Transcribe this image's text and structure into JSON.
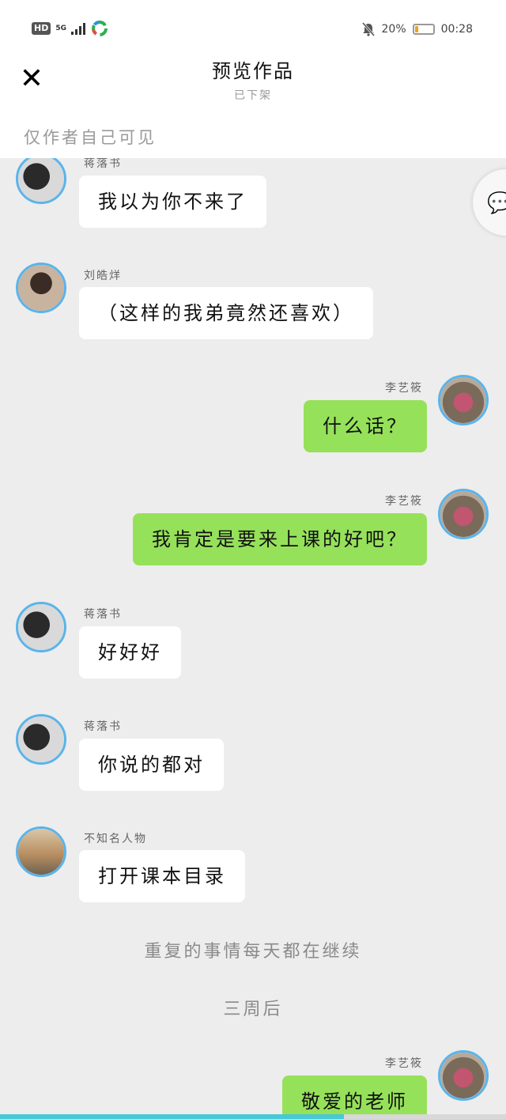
{
  "status_bar": {
    "hd": "HD",
    "network": "5G",
    "battery_percent_label": "20%",
    "battery_level": 0.2,
    "time": "00:28"
  },
  "header": {
    "title": "预览作品",
    "subtitle": "已下架",
    "visibility_note": "仅作者自己可见"
  },
  "messages": [
    {
      "speaker": "蒋落书",
      "text": "我以为你不来了",
      "side": "left"
    },
    {
      "speaker": "刘皓烊",
      "text": "（这样的我弟竟然还喜欢）",
      "side": "left"
    },
    {
      "speaker": "李艺筱",
      "text": "什么话？",
      "side": "right"
    },
    {
      "speaker": "李艺筱",
      "text": "我肯定是要来上课的好吧？",
      "side": "right"
    },
    {
      "speaker": "蒋落书",
      "text": "好好好",
      "side": "left"
    },
    {
      "speaker": "蒋落书",
      "text": "你说的都对",
      "side": "left"
    },
    {
      "speaker": "不知名人物",
      "text": "打开课本目录",
      "side": "left"
    }
  ],
  "narrations": [
    "重复的事情每天都在继续",
    "三周后"
  ],
  "last_message": {
    "speaker": "李艺筱",
    "text": "敬爱的老师",
    "side": "right"
  },
  "icons": {
    "close": "close-icon",
    "comment": "comment-icon",
    "mute": "bell-off-icon"
  },
  "colors": {
    "bubble_right": "#96e15a",
    "bubble_left": "#ffffff",
    "avatar_ring": "#5ab4ea",
    "progress": "#4ac8d6"
  },
  "reading_progress": 0.68
}
